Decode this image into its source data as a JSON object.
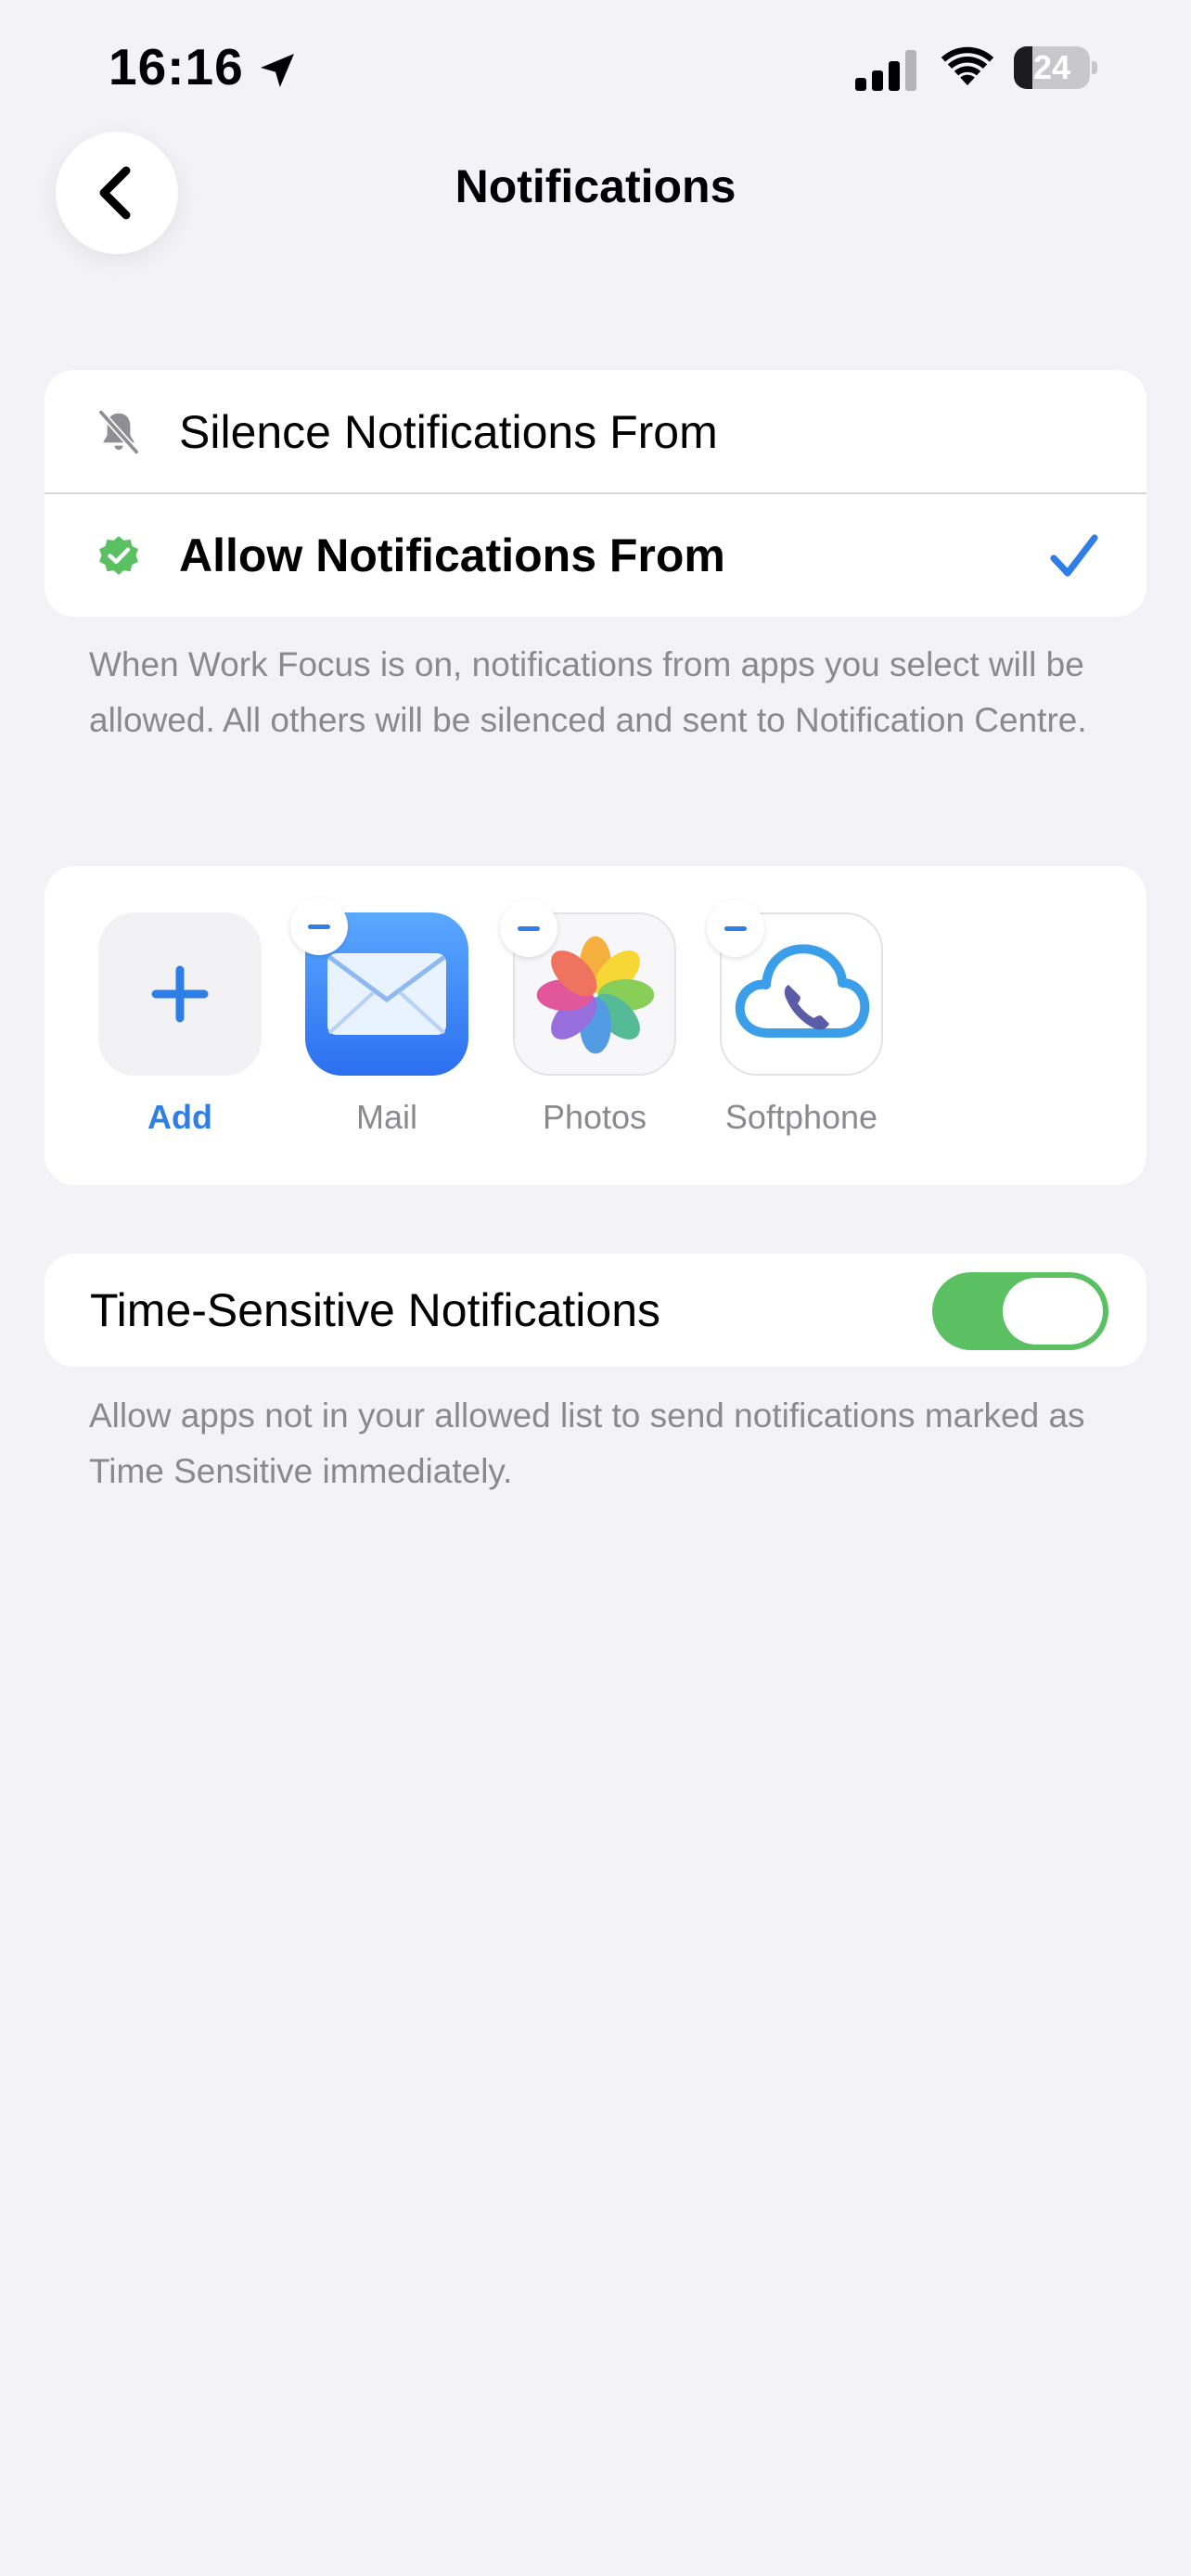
{
  "status_bar": {
    "time": "16:16",
    "battery": "24",
    "battery_level": 0.24
  },
  "header": {
    "title": "Notifications",
    "back_icon": "chevron-left-icon"
  },
  "mode": {
    "silence_label": "Silence Notifications From",
    "allow_label": "Allow Notifications From",
    "selected": "allow"
  },
  "mode_footnote": "When Work Focus is on, notifications from apps you select will be allowed. All others will be silenced and sent to Notification Centre.",
  "apps": {
    "add_label": "Add",
    "items": [
      {
        "label": "Mail",
        "icon": "mail-app-icon"
      },
      {
        "label": "Photos",
        "icon": "photos-app-icon"
      },
      {
        "label": "Softphone",
        "icon": "softphone-app-icon"
      }
    ]
  },
  "time_sensitive": {
    "label": "Time-Sensitive Notifications",
    "enabled": true,
    "footnote": "Allow apps not in your allowed list to send notifications marked as Time Sensitive immediately."
  },
  "colors": {
    "accent": "#2e7ee5",
    "toggle_on": "#5ac061",
    "background": "#f2f2f7"
  }
}
